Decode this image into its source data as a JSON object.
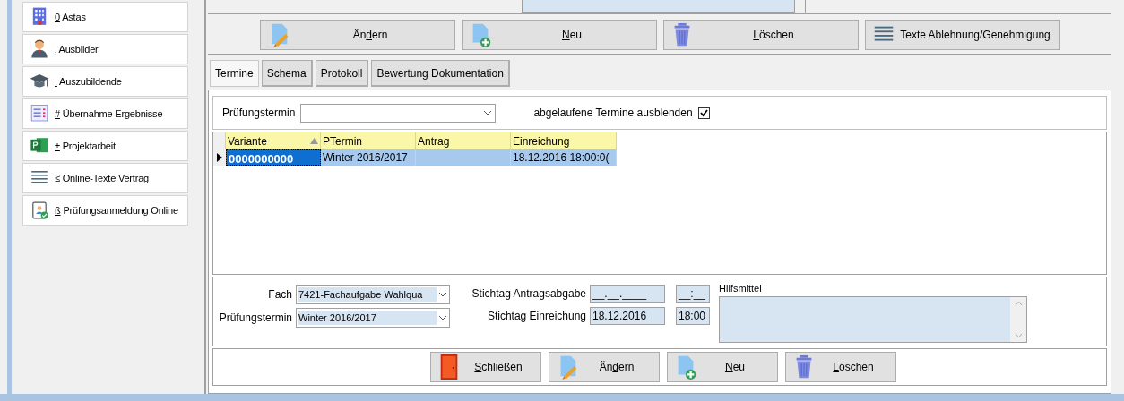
{
  "sidebar": {
    "items": [
      {
        "key": "0",
        "label": "Astas"
      },
      {
        "key": "‚",
        "label": "Ausbilder"
      },
      {
        "key": ".",
        "label": "Auszubildende"
      },
      {
        "key": "#",
        "label": "Übernahme Ergebnisse"
      },
      {
        "key": "±",
        "label": "Projektarbeit"
      },
      {
        "key": "≤",
        "label": "Online-Texte Vertrag"
      },
      {
        "key": "ß",
        "label": "Prüfungsanmeldung Online"
      }
    ]
  },
  "toolbar": [
    {
      "pre": "Än",
      "key": "d",
      "post": "ern"
    },
    {
      "key": "N",
      "post": "eu"
    },
    {
      "key": "L",
      "post": "öschen"
    },
    {
      "pre": "Texte Ablehnung/Genehmigung"
    }
  ],
  "tabs": [
    {
      "label": "Termine",
      "selected": true
    },
    {
      "label": "Schema",
      "selected": false
    },
    {
      "label": "Protokoll",
      "selected": false
    },
    {
      "label": "Bewertung Dokumentation",
      "selected": false
    }
  ],
  "filter": {
    "label": "Prüfungstermin",
    "hide_label": "abgelaufene Termine ausblenden",
    "hide_checked": true
  },
  "table": {
    "columns": [
      {
        "label": "Variante",
        "sorted": true
      },
      {
        "label": "PTermin",
        "sorted": false
      },
      {
        "label": "Antrag",
        "sorted": false
      },
      {
        "label": "Einreichung",
        "sorted": false
      }
    ],
    "rows": [
      {
        "current": true,
        "cells": [
          "0000000000",
          "Winter 2016/2017",
          "",
          "18.12.2016 18:00:0("
        ]
      }
    ]
  },
  "details": {
    "fach_label": "Fach",
    "fach": "7421-Fachaufgabe Wahlqua",
    "termin_label": "Prüfungstermin",
    "termin": "Winter 2016/2017",
    "antrag_label": "Stichtag Antragsabgabe",
    "antrag_date": "__.__.____",
    "antrag_time": "__:__",
    "einreichung_label": "Stichtag Einreichung",
    "einreichung_date": "18.12.2016",
    "einreichung_time": "18:00",
    "hilfsmittel_label": "Hilfsmittel"
  },
  "bottom_buttons": [
    {
      "key": "S",
      "post": "chließen"
    },
    {
      "pre": "Än",
      "key": "d",
      "post": "ern"
    },
    {
      "key": "N",
      "post": "eu"
    },
    {
      "key": "L",
      "post": "öschen"
    }
  ]
}
